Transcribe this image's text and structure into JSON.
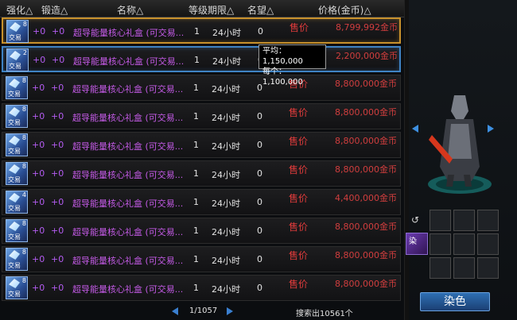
{
  "header": {
    "col_enhance": "强化△",
    "col_forge": "锻造△",
    "col_name": "名称△",
    "col_level_period": "等级期限△",
    "col_fame": "名望△",
    "col_price": "价格(金币)△"
  },
  "rows": [
    {
      "count": "8",
      "trade": "交易",
      "enhance": "+0",
      "forge": "+0",
      "name": "超导能量核心礼盒 (可交易...",
      "level": "1",
      "period": "24小时",
      "fame": "0",
      "sell": "售价",
      "price": "8,799,992金币"
    },
    {
      "count": "2",
      "trade": "交易",
      "enhance": "+0",
      "forge": "+0",
      "name": "超导能量核心礼盒 (可交易...",
      "level": "1",
      "period": "24小时",
      "fame": "0",
      "sell": "售价",
      "price": "2,200,000金币"
    },
    {
      "count": "8",
      "trade": "交易",
      "enhance": "+0",
      "forge": "+0",
      "name": "超导能量核心礼盒 (可交易...",
      "level": "1",
      "period": "24小时",
      "fame": "0",
      "sell": "售价",
      "price": "8,800,000金币"
    },
    {
      "count": "8",
      "trade": "交易",
      "enhance": "+0",
      "forge": "+0",
      "name": "超导能量核心礼盒 (可交易...",
      "level": "1",
      "period": "24小时",
      "fame": "0",
      "sell": "售价",
      "price": "8,800,000金币"
    },
    {
      "count": "8",
      "trade": "交易",
      "enhance": "+0",
      "forge": "+0",
      "name": "超导能量核心礼盒 (可交易...",
      "level": "1",
      "period": "24小时",
      "fame": "0",
      "sell": "售价",
      "price": "8,800,000金币"
    },
    {
      "count": "8",
      "trade": "交易",
      "enhance": "+0",
      "forge": "+0",
      "name": "超导能量核心礼盒 (可交易...",
      "level": "1",
      "period": "24小时",
      "fame": "0",
      "sell": "售价",
      "price": "8,800,000金币"
    },
    {
      "count": "4",
      "trade": "交易",
      "enhance": "+0",
      "forge": "+0",
      "name": "超导能量核心礼盒 (可交易...",
      "level": "1",
      "period": "24小时",
      "fame": "0",
      "sell": "售价",
      "price": "4,400,000金币"
    },
    {
      "count": "8",
      "trade": "交易",
      "enhance": "+0",
      "forge": "+0",
      "name": "超导能量核心礼盒 (可交易...",
      "level": "1",
      "period": "24小时",
      "fame": "0",
      "sell": "售价",
      "price": "8,800,000金币"
    },
    {
      "count": "8",
      "trade": "交易",
      "enhance": "+0",
      "forge": "+0",
      "name": "超导能量核心礼盒 (可交易...",
      "level": "1",
      "period": "24小时",
      "fame": "0",
      "sell": "售价",
      "price": "8,800,000金币"
    },
    {
      "count": "8",
      "trade": "交易",
      "enhance": "+0",
      "forge": "+0",
      "name": "超导能量核心礼盒 (可交易...",
      "level": "1",
      "period": "24小时",
      "fame": "0",
      "sell": "售价",
      "price": "8,800,000金币"
    }
  ],
  "tooltip": {
    "average": "平均：1,150,000",
    "each": "每个：1,100,000"
  },
  "pager": {
    "page": "1/1057",
    "search_result": "搜索出10561个"
  },
  "side": {
    "return_icon": "↺",
    "dye_tag": "染",
    "dye_button": "染色"
  },
  "colors": {
    "selected_gold": "#c8912c",
    "selected_blue": "#3f83c4",
    "price_red": "#d13e3e",
    "item_purple": "#c55be8"
  }
}
